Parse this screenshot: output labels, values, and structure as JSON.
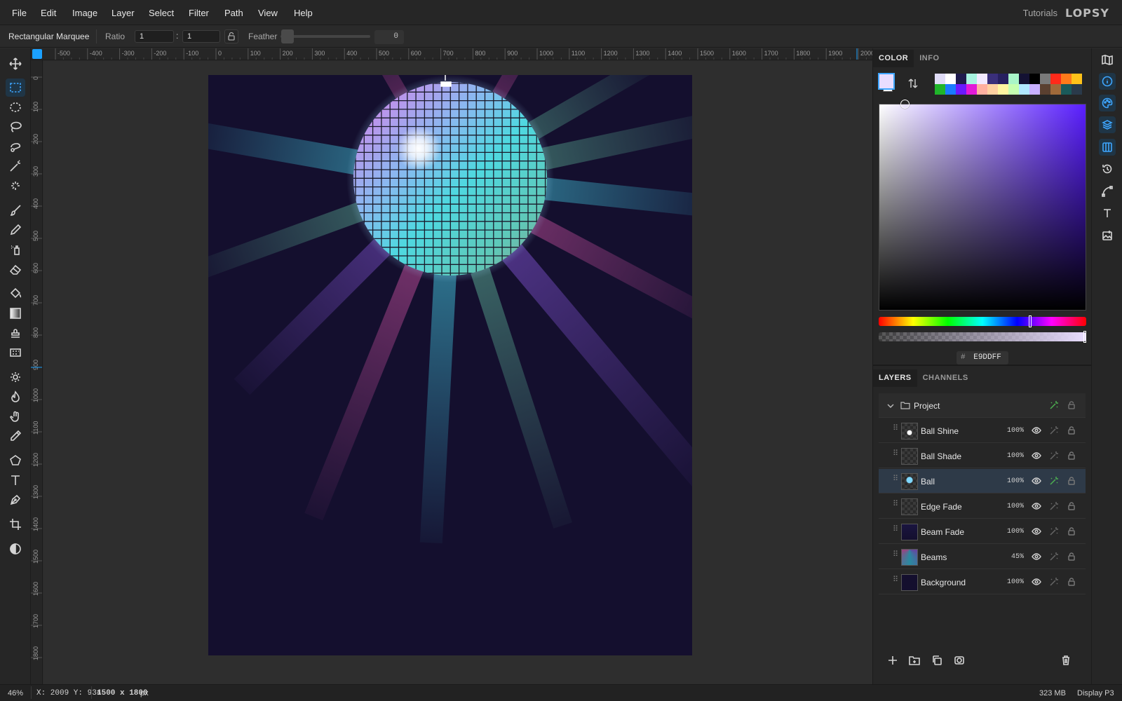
{
  "menubar": {
    "items": [
      "File",
      "Edit",
      "Image",
      "Layer",
      "Select",
      "Filter",
      "Path",
      "View",
      "Help"
    ],
    "tutorials": "Tutorials",
    "logo": "LOPSY"
  },
  "options": {
    "tool_name": "Rectangular Marquee",
    "ratio_label": "Ratio",
    "ratio_w": "1",
    "ratio_h": "1",
    "ratio_sep": ":",
    "feather_label": "Feather",
    "feather_value": "0"
  },
  "rulers": {
    "top": [
      "-500",
      "-400",
      "-300",
      "-200",
      "-100",
      "0",
      "100",
      "200",
      "300",
      "400",
      "500",
      "600",
      "700",
      "800",
      "900",
      "1000",
      "1100",
      "1200",
      "1300",
      "1400",
      "1500",
      "1600",
      "1700",
      "1800",
      "1900",
      "2000"
    ],
    "left": [
      "0",
      "100",
      "200",
      "300",
      "400",
      "500",
      "600",
      "700",
      "800",
      "900",
      "1000",
      "1100",
      "1200",
      "1300",
      "1400",
      "1500",
      "1600",
      "1700",
      "1800"
    ]
  },
  "toolbar": {
    "tools": [
      "move-icon",
      "rect-marquee-icon",
      "ellipse-marquee-icon",
      "lasso-icon",
      "object-select-icon",
      "magic-wand-icon",
      "quick-select-icon",
      "brush-icon",
      "pencil-icon",
      "spray-icon",
      "eraser-icon",
      "paint-bucket-icon",
      "gradient-icon",
      "stamp-icon",
      "pattern-icon",
      "dodge-icon",
      "burn-icon",
      "smudge-icon",
      "eyedropper-icon",
      "shape-icon",
      "text-icon",
      "pen-icon",
      "crop-icon",
      "contrast-icon"
    ],
    "active": "rect-marquee-icon"
  },
  "color_panel": {
    "tabs": [
      "COLOR",
      "INFO"
    ],
    "active_tab": "COLOR",
    "foreground": "#E9DDFF",
    "background": "#FFFFFF",
    "hex_prefix": "#",
    "hex_value": "E9DDFF",
    "hue_color": "#5a1fff",
    "swatches_top": [
      "#e0dcf7",
      "#ffffff",
      "#1f1b4d",
      "#a7f3e0",
      "#f2e9ff",
      "#3a2f7a",
      "#27205f",
      "#a9f5c8",
      "#141233",
      "#000000",
      "#7a7a7a",
      "#ff2a1a",
      "#ff7a1a",
      "#ffc21a"
    ],
    "swatches_bottom": [
      "#1fb52a",
      "#1a7aff",
      "#6a1aff",
      "#e21ad8",
      "#ffb0a0",
      "#ffd0a0",
      "#fff5a0",
      "#c5ffb0",
      "#b0e8ff",
      "#c8b0ff",
      "#5a4030",
      "#a06a3a",
      "#1a5a5a",
      "#2a3a4a"
    ]
  },
  "layers_panel": {
    "tabs": [
      "LAYERS",
      "CHANNELS"
    ],
    "active_tab": "LAYERS",
    "group": "Project",
    "selected": "Ball",
    "layers": [
      {
        "name": "Ball Shine",
        "opacity": "100%"
      },
      {
        "name": "Ball Shade",
        "opacity": "100%"
      },
      {
        "name": "Ball",
        "opacity": "100%"
      },
      {
        "name": "Edge Fade",
        "opacity": "100%"
      },
      {
        "name": "Beam Fade",
        "opacity": "100%"
      },
      {
        "name": "Beams",
        "opacity": "45%"
      },
      {
        "name": "Background",
        "opacity": "100%"
      }
    ],
    "bottom_actions": [
      "add-layer-icon",
      "add-folder-icon",
      "duplicate-icon",
      "mask-icon",
      "trash-icon"
    ]
  },
  "iconbar": {
    "items": [
      "map-icon",
      "info-icon",
      "palette-icon",
      "layers-icon",
      "columns-icon",
      "history-icon",
      "path-icon",
      "type-icon",
      "image-icon"
    ],
    "active": [
      "info-icon",
      "palette-icon",
      "layers-icon",
      "columns-icon"
    ]
  },
  "status": {
    "zoom": "46%",
    "coords": "X: 2009 Y: 934",
    "doc_size_value": "1500 x 1800",
    "doc_size_unit": "px",
    "memory": "323 MB",
    "display": "Display P3"
  }
}
